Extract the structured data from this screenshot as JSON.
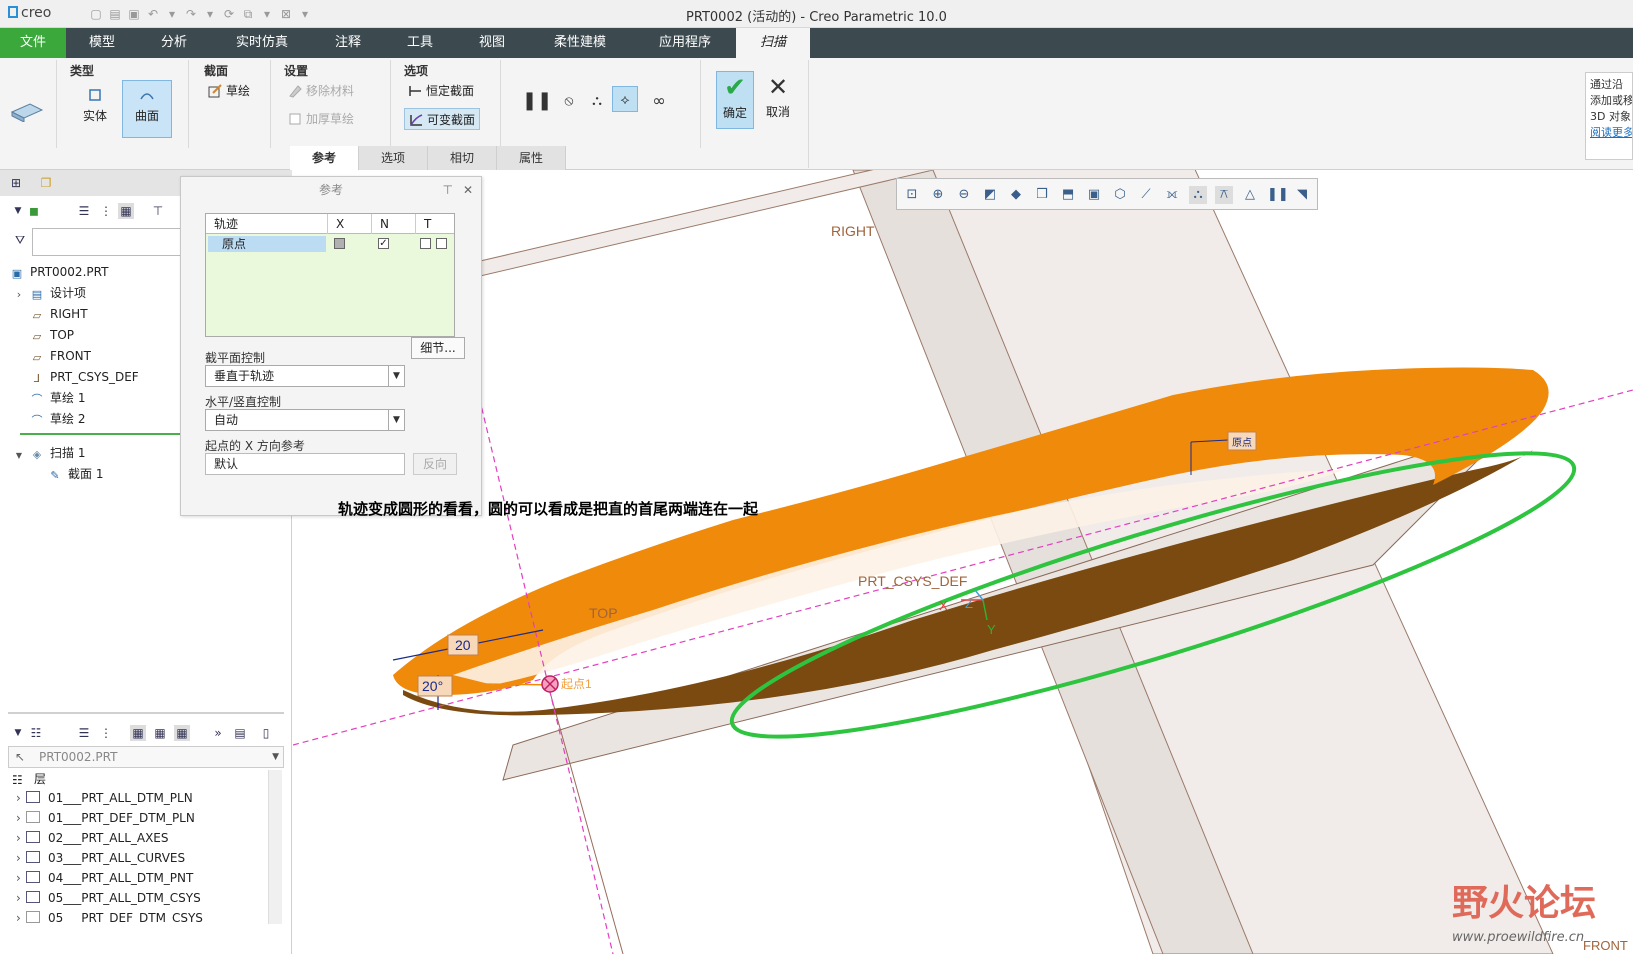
{
  "window": {
    "app_logo": "creo",
    "title": "PRT0002 (活动的) - Creo Parametric 10.0"
  },
  "menu_tabs": [
    {
      "label": "文件"
    },
    {
      "label": "模型"
    },
    {
      "label": "分析"
    },
    {
      "label": "实时仿真"
    },
    {
      "label": "注释"
    },
    {
      "label": "工具"
    },
    {
      "label": "视图"
    },
    {
      "label": "柔性建模"
    },
    {
      "label": "应用程序"
    },
    {
      "label": "扫描"
    }
  ],
  "ribbon": {
    "type_group": {
      "title": "类型",
      "solid": "实体",
      "surface": "曲面"
    },
    "section_group": {
      "title": "截面",
      "sketch": "草绘"
    },
    "settings_group": {
      "title": "设置",
      "remove_material": "移除材料",
      "thicken_sketch": "加厚草绘"
    },
    "options_group": {
      "title": "选项",
      "constant_section": "恒定截面",
      "variable_section": "可变截面"
    },
    "ok": "确定",
    "cancel": "取消",
    "subtabs": [
      "参考",
      "选项",
      "相切",
      "属性"
    ],
    "hint_lines": [
      "通过沿",
      "添加或移",
      "3D 对象"
    ],
    "hint_link": "阅读更多"
  },
  "model_tree": {
    "root": "PRT0002.PRT",
    "items": [
      "设计项",
      "RIGHT",
      "TOP",
      "FRONT",
      "PRT_CSYS_DEF",
      "草绘 1",
      "草绘 2"
    ],
    "sweep": "扫描 1",
    "section": "截面 1"
  },
  "layer_tree": {
    "model_select": "PRT0002.PRT",
    "header": "层",
    "items": [
      "01___PRT_ALL_DTM_PLN",
      "01___PRT_DEF_DTM_PLN",
      "02___PRT_ALL_AXES",
      "03___PRT_ALL_CURVES",
      "04___PRT_ALL_DTM_PNT",
      "05___PRT_ALL_DTM_CSYS",
      "05___PRT_DEF_DTM_CSYS"
    ]
  },
  "reference_panel": {
    "title": "参考",
    "columns": [
      "轨迹",
      "X",
      "N",
      "T"
    ],
    "row_label": "原点",
    "row_x_checked": false,
    "row_n_checked": true,
    "detail_button": "细节...",
    "section_plane_label": "截平面控制",
    "section_plane_value": "垂直于轨迹",
    "hv_control_label": "水平/竖直控制",
    "hv_control_value": "自动",
    "x_ref_label": "起点的 X 方向参考",
    "x_ref_value": "默认",
    "reverse_button": "反向"
  },
  "graphics": {
    "annotation": "轨迹变成圆形的看看，圆的可以看成是把直的首尾两端连在一起",
    "plane_right": "RIGHT",
    "plane_top": "TOP",
    "plane_front": "FRONT",
    "csys": "PRT_CSYS_DEF",
    "origin_tag": "原点",
    "dim_20": "20",
    "dim_20deg": "20°",
    "axis_x": "X",
    "axis_y": "Y",
    "axis_z": "Z",
    "start_label": "起点1",
    "orange_color": "#f08a0a",
    "dark_color": "#7a4a10",
    "trajectory_color": "#2ec440"
  },
  "watermark": {
    "brand": "野火论坛",
    "url": "www.proewildfire.cn"
  }
}
